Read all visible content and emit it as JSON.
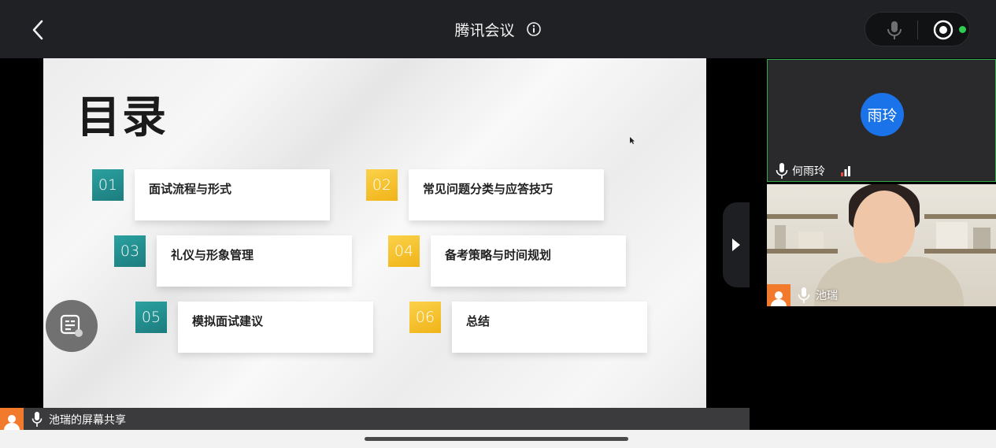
{
  "header": {
    "title": "腾讯会议",
    "back_icon": "chevron-left-icon",
    "info_icon": "info-icon",
    "mic_icon": "mic-icon",
    "record_icon": "record-icon",
    "status_color": "#2ecc52"
  },
  "slide": {
    "title": "目录",
    "items": [
      {
        "num": "01",
        "label": "面试流程与形式",
        "color": "teal"
      },
      {
        "num": "02",
        "label": "常见问题分类与应答技巧",
        "color": "gold"
      },
      {
        "num": "03",
        "label": "礼仪与形象管理",
        "color": "teal"
      },
      {
        "num": "04",
        "label": "备考策略与时间规划",
        "color": "gold"
      },
      {
        "num": "05",
        "label": "模拟面试建议",
        "color": "teal"
      },
      {
        "num": "06",
        "label": "总结",
        "color": "gold"
      }
    ],
    "accent_teal": "#2aa1a0",
    "accent_gold": "#f5c02e"
  },
  "share_bar": {
    "label": "池瑞的屏幕共享"
  },
  "participants": [
    {
      "avatar_text": "雨玲",
      "name": "何雨玲",
      "avatar_color": "#1a73e8"
    },
    {
      "name": "池瑞"
    }
  ]
}
